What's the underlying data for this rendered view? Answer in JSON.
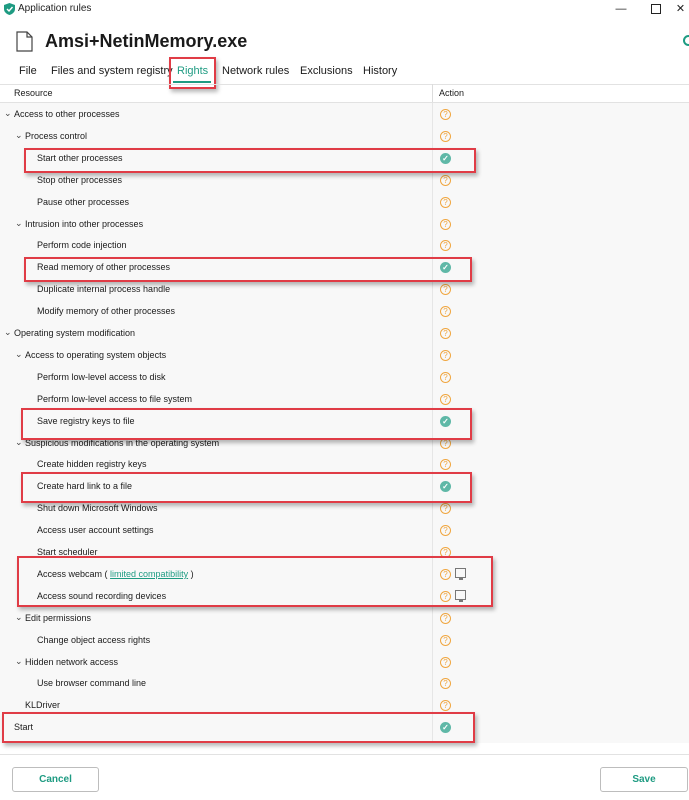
{
  "window": {
    "title": "Application rules",
    "minimize": "—",
    "close": "✕"
  },
  "app_name": "Amsi+NetinMemory.exe",
  "tabs": [
    {
      "label": "File"
    },
    {
      "label": "Files and system registry"
    },
    {
      "label": "Rights"
    },
    {
      "label": "Network rules"
    },
    {
      "label": "Exclusions"
    },
    {
      "label": "History"
    }
  ],
  "active_tab": "Rights",
  "columns": {
    "resource": "Resource",
    "action": "Action"
  },
  "rows": [
    {
      "label": "Access to other processes",
      "level": 0,
      "expanded": true,
      "action": "ask"
    },
    {
      "label": "Process control",
      "level": 1,
      "expanded": true,
      "action": "ask"
    },
    {
      "label": "Start other processes",
      "level": 2,
      "action": "allow"
    },
    {
      "label": "Stop other processes",
      "level": 2,
      "action": "ask"
    },
    {
      "label": "Pause other processes",
      "level": 2,
      "action": "ask"
    },
    {
      "label": "Intrusion into other processes",
      "level": 1,
      "expanded": true,
      "action": "ask"
    },
    {
      "label": "Perform code injection",
      "level": 2,
      "action": "ask"
    },
    {
      "label": "Read memory of other processes",
      "level": 2,
      "action": "allow"
    },
    {
      "label": "Duplicate internal process handle",
      "level": 2,
      "action": "ask"
    },
    {
      "label": "Modify memory of other processes",
      "level": 2,
      "action": "ask"
    },
    {
      "label": "Operating system modification",
      "level": 0,
      "expanded": true,
      "action": "ask"
    },
    {
      "label": "Access to operating system objects",
      "level": 1,
      "expanded": true,
      "action": "ask"
    },
    {
      "label": "Perform low-level access to disk",
      "level": 2,
      "action": "ask"
    },
    {
      "label": "Perform low-level access to file system",
      "level": 2,
      "action": "ask"
    },
    {
      "label": "Save registry keys to file",
      "level": 2,
      "action": "allow"
    },
    {
      "label": "Suspicious modifications in the operating system",
      "level": 1,
      "expanded": true,
      "action": "ask"
    },
    {
      "label": "Create hidden registry keys",
      "level": 2,
      "action": "ask"
    },
    {
      "label": "Create hard link to a file",
      "level": 2,
      "action": "allow"
    },
    {
      "label": "Shut down Microsoft Windows",
      "level": 2,
      "action": "ask"
    },
    {
      "label": "Access user account settings",
      "level": 2,
      "action": "ask"
    },
    {
      "label": "Start scheduler",
      "level": 2,
      "action": "ask"
    },
    {
      "label": "Access webcam (",
      "link": "limited compatibility",
      "suffix": ")",
      "level": 2,
      "action": "ask",
      "monitor": true
    },
    {
      "label": "Access sound recording devices",
      "level": 2,
      "action": "ask",
      "monitor": true
    },
    {
      "label": "Edit permissions",
      "level": 1,
      "expanded": true,
      "action": "ask"
    },
    {
      "label": "Change object access rights",
      "level": 2,
      "action": "ask"
    },
    {
      "label": "Hidden network access",
      "level": 1,
      "expanded": true,
      "action": "ask"
    },
    {
      "label": "Use browser command line",
      "level": 2,
      "action": "ask"
    },
    {
      "label": "KLDriver",
      "level": 1,
      "action": "ask"
    },
    {
      "label": "Start",
      "level": 0,
      "action": "allow"
    }
  ],
  "icons": {
    "ask": "question-circle-icon",
    "allow": "check-circle-icon",
    "monitor": "monitor-icon",
    "expand": "chevron-down-icon"
  },
  "colors": {
    "accent": "#1e9b82",
    "ask": "#f0a640",
    "allow": "#5fb8a7",
    "highlight": "#e03c46"
  },
  "buttons": {
    "cancel": "Cancel",
    "save": "Save"
  }
}
